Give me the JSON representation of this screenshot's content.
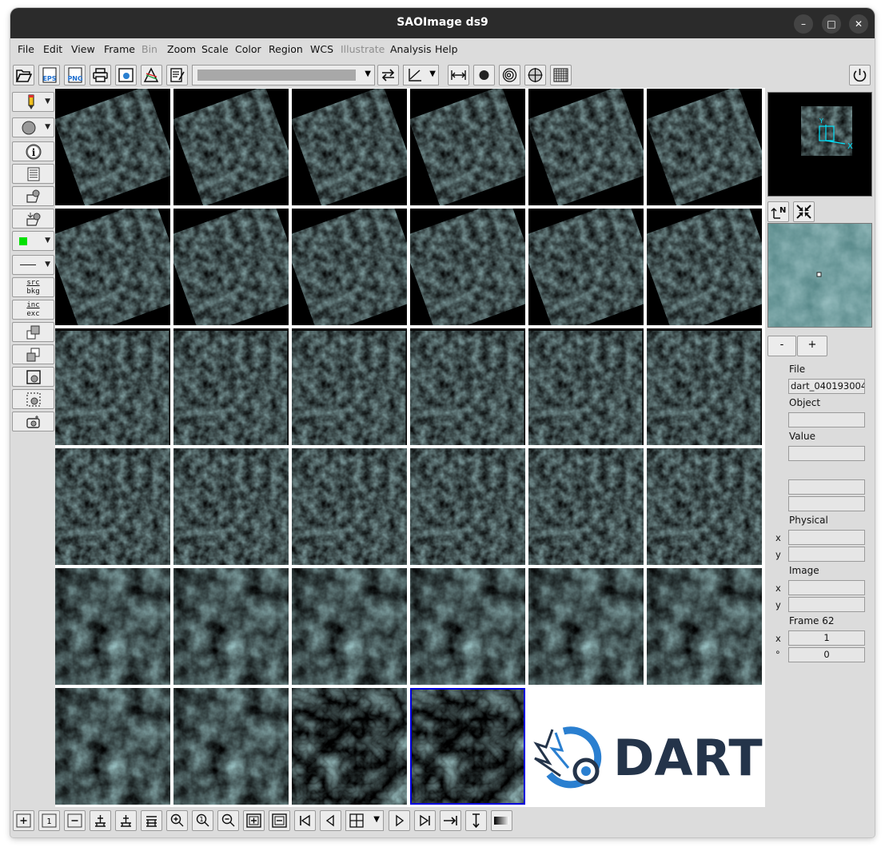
{
  "window": {
    "title": "SAOImage ds9"
  },
  "menu": [
    "File",
    "Edit",
    "View",
    "Frame",
    "Bin",
    "Zoom",
    "Scale",
    "Color",
    "Region",
    "WCS",
    "Illustrate",
    "Analysis",
    "Help"
  ],
  "menu_disabled": [
    "Bin",
    "Illustrate"
  ],
  "toolbar": {
    "eps_label": "EPS",
    "png_label": "PNG"
  },
  "leftbar": {
    "src_label": "src",
    "bkg_label": "bkg",
    "inc_label": "inc",
    "exc_label": "exc",
    "color_swatch": "#00e000"
  },
  "grid": {
    "columns": 6,
    "rows": 6,
    "frames_shown": 34,
    "selected_frame": 34,
    "tint": "#5f9a9a",
    "logo_text": "DART",
    "logo_color": "#24344a",
    "logo_accent": "#2a7fd0"
  },
  "panel": {
    "compass_north": "N",
    "zoom_out": "-",
    "zoom_in": "+",
    "file_label": "File",
    "file_value": "dart_040193004",
    "object_label": "Object",
    "object_value": "",
    "value_label": "Value",
    "value_value": "",
    "physical_label": "Physical",
    "physical_x_label": "x",
    "physical_y_label": "y",
    "image_label": "Image",
    "image_x_label": "x",
    "image_y_label": "y",
    "frame_label": "Frame 62",
    "frame_x_label": "x",
    "frame_x_value": "1",
    "frame_angle_label": "°",
    "frame_angle_value": "0"
  }
}
